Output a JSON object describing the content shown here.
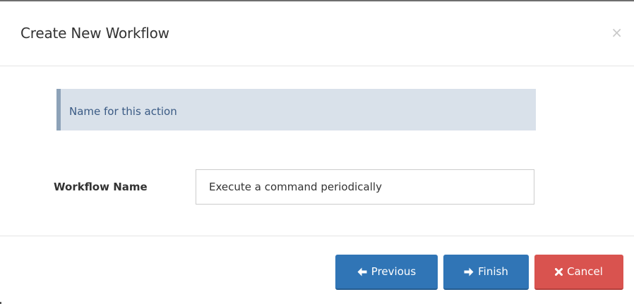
{
  "dialog": {
    "title": "Create New Workflow",
    "close_glyph": "×"
  },
  "info": {
    "text": "Name for this action"
  },
  "form": {
    "workflow_name_label": "Workflow Name",
    "workflow_name_value": "Execute a command periodically"
  },
  "buttons": {
    "previous_label": "Previous",
    "previous_icon": "arrow-left-icon",
    "finish_label": "Finish",
    "finish_icon": "arrow-right-icon",
    "cancel_label": "Cancel",
    "cancel_icon": "times-icon"
  },
  "colors": {
    "primary": "#3075b6",
    "danger": "#d9534f",
    "info_bg": "#d9e1ea",
    "info_text": "#3a5a84"
  }
}
